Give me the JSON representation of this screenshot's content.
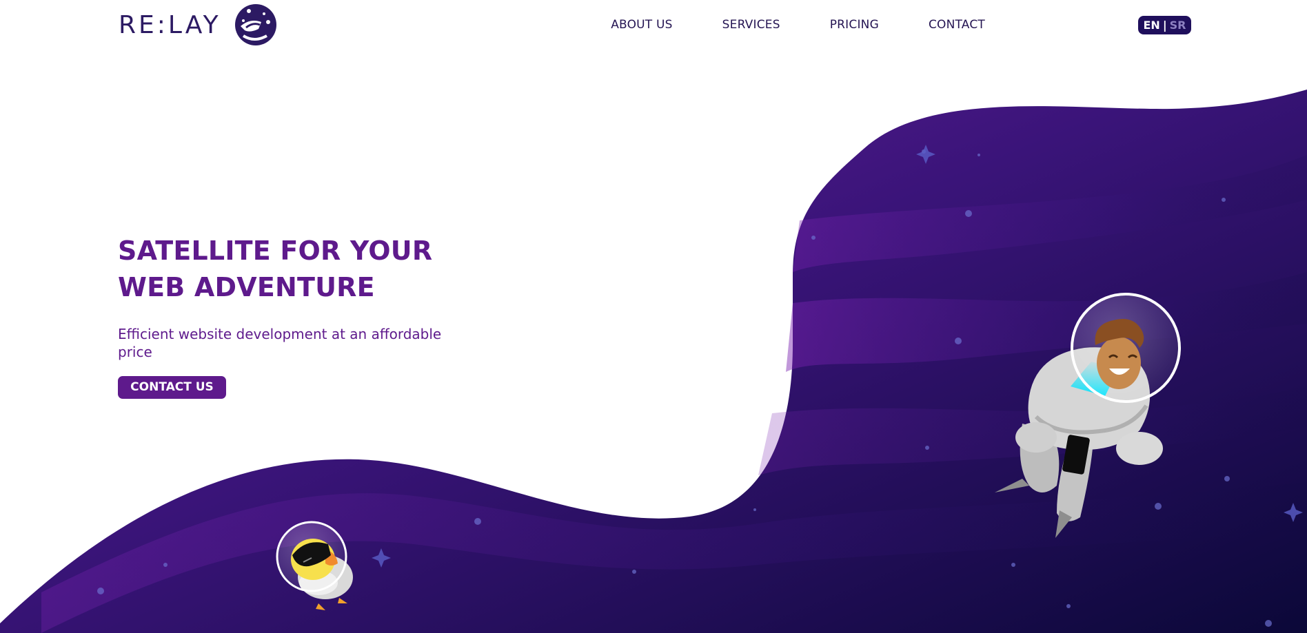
{
  "brand": {
    "name": "RE:LAY",
    "logo_icon": "astronaut-chick-icon",
    "color_primary": "#2c1a63",
    "color_accent": "#5e1a8c"
  },
  "nav": {
    "items": [
      {
        "label": "ABOUT US"
      },
      {
        "label": "SERVICES"
      },
      {
        "label": "PRICING"
      },
      {
        "label": "CONTACT"
      }
    ]
  },
  "language": {
    "active": "EN",
    "separator": "|",
    "inactive": "SR"
  },
  "hero": {
    "title_line1": "SATELLITE FOR YOUR",
    "title_line2": "WEB ADVENTURE",
    "subtitle": "Efficient website development at an affordable price",
    "cta_label": "CONTACT US"
  },
  "illustrations": {
    "background": "purple-space-wave",
    "left_character": "astronaut-chick-icon",
    "right_character": "astronaut-boy-with-phone-icon"
  }
}
